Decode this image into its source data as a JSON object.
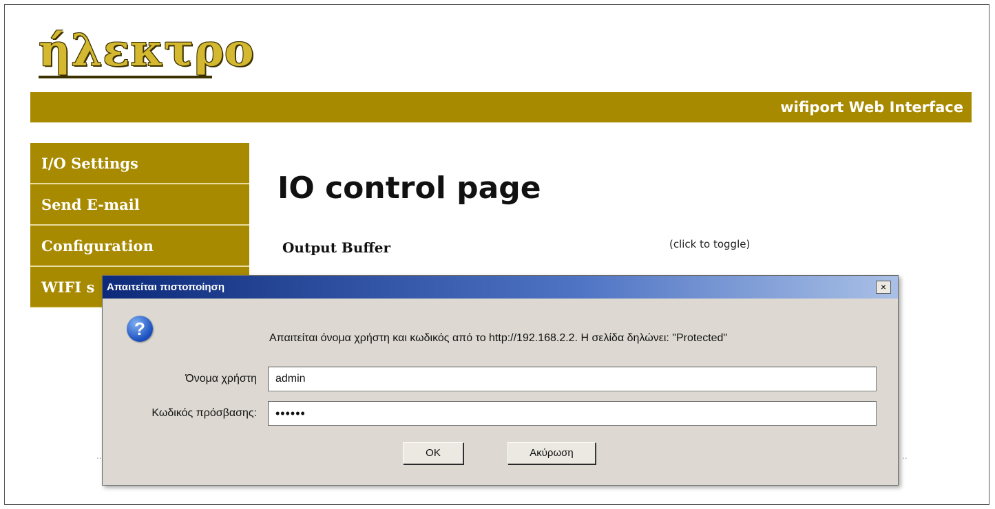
{
  "logo_text": "ήλεκτρο",
  "header": {
    "title": "wifiport Web Interface"
  },
  "sidebar": {
    "items": [
      {
        "label": "I/O Settings"
      },
      {
        "label": "Send E-mail"
      },
      {
        "label": "Configuration"
      },
      {
        "label": "WIFI s"
      }
    ]
  },
  "main": {
    "title": "IO control page",
    "output_buffer_label": "Output Buffer",
    "toggle_hint": "(click to toggle)",
    "dots_left": "..",
    "dots_right": ".."
  },
  "dialog": {
    "title": "Απαιτείται πιστοποίηση",
    "close_glyph": "×",
    "icon": "question-icon",
    "message": "Απαιτείται όνομα χρήστη και κωδικός από το http://192.168.2.2. Η σελίδα δηλώνει: \"Protected\"",
    "username_label": "Όνομα χρήστη",
    "username_value": "admin",
    "password_label": "Κωδικός πρόσβασης:",
    "password_value": "••••••",
    "ok_label": "OK",
    "cancel_label": "Ακύρωση"
  },
  "colors": {
    "accent": "#a88a00",
    "logo": "#d4b830",
    "dialog_title": "#0d2a7a"
  }
}
